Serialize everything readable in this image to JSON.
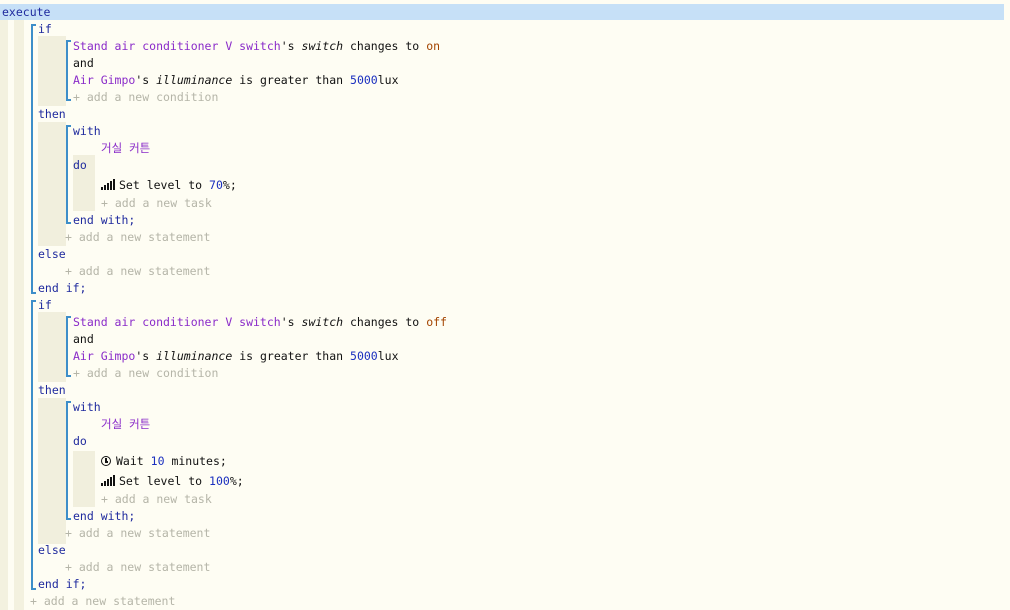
{
  "execute": "execute",
  "block1": {
    "if": "if",
    "cond1": {
      "device": "Stand air conditioner V switch",
      "poss": "'s",
      "attr": "switch",
      "verb": "changes to",
      "value": "on"
    },
    "and": "and",
    "cond2": {
      "device": "Air Gimpo",
      "poss": "'s",
      "attr": "illuminance",
      "verb": "is greater than",
      "value": "5000",
      "unit": "lux"
    },
    "add_condition": "+ add a new condition",
    "then": "then",
    "with": "with",
    "with_target": "거실 커튼",
    "do": "do",
    "task1": {
      "text_a": "Set level to",
      "value": "70",
      "text_b": "%;"
    },
    "add_task": "+ add a new task",
    "end_with": "end with;",
    "add_statement": "+ add a new statement",
    "else": "else",
    "add_statement_else": "+ add a new statement",
    "end_if": "end if;"
  },
  "block2": {
    "if": "if",
    "cond1": {
      "device": "Stand air conditioner V switch",
      "poss": "'s",
      "attr": "switch",
      "verb": "changes to",
      "value": "off"
    },
    "and": "and",
    "cond2": {
      "device": "Air Gimpo",
      "poss": "'s",
      "attr": "illuminance",
      "verb": "is greater than",
      "value": "5000",
      "unit": "lux"
    },
    "add_condition": "+ add a new condition",
    "then": "then",
    "with": "with",
    "with_target": "거실 커튼",
    "do": "do",
    "task1": {
      "text_a": "Wait",
      "value": "10",
      "text_b": "minutes;"
    },
    "task2": {
      "text_a": "Set level to",
      "value": "100",
      "text_b": "%;"
    },
    "add_task": "+ add a new task",
    "end_with": "end with;",
    "add_statement": "+ add a new statement",
    "else": "else",
    "add_statement_else": "+ add a new statement",
    "end_if": "end if;"
  },
  "add_statement_root": "+ add a new statement",
  "icons": {
    "level": "signal-bars-icon",
    "wait": "clock-icon"
  }
}
